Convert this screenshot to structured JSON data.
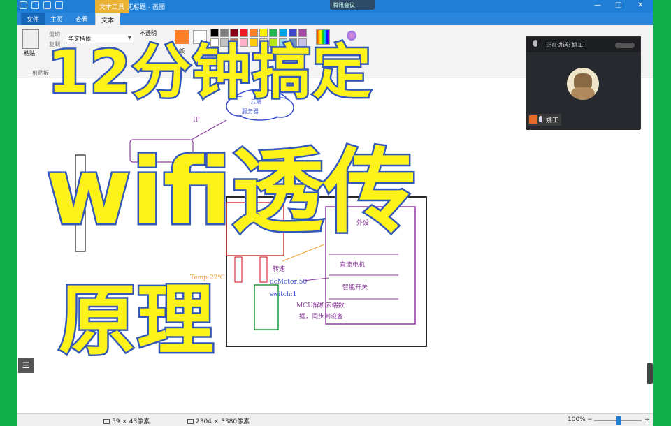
{
  "window": {
    "context_tab": "文本工具",
    "title": "无标题 - 画图",
    "meeting_label": "腾讯会议",
    "minimize": "—",
    "maximize": "□",
    "close": "✕"
  },
  "tabs": [
    {
      "label": "文件"
    },
    {
      "label": "主页"
    },
    {
      "label": "查看"
    },
    {
      "label": "文本"
    }
  ],
  "ribbon": {
    "paste": "粘贴",
    "cut": "剪切",
    "copy": "复制",
    "clipboard_group": "剪贴板",
    "font_name": "华文楷体",
    "opaque": "不透明",
    "palette": [
      "#000000",
      "#7f7f7f",
      "#880015",
      "#ed1c24",
      "#ff7f27",
      "#fff200",
      "#22b14c",
      "#00a2e8",
      "#3f48cc",
      "#a349a4",
      "#ffffff",
      "#c3c3c3",
      "#b97a57",
      "#ffaec9",
      "#ffc90e",
      "#efe4b0",
      "#b5e61d",
      "#99d9ea",
      "#7092be",
      "#c8bfe7"
    ],
    "color1_hex": "#ff7f27",
    "color2_hex": "#ffffff",
    "color1_label": "颜",
    "color2_label": ""
  },
  "diagram": {
    "cloud_line1": "云端",
    "cloud_line2": "服务器",
    "ip_label": "IP",
    "temp_label": "Temp:22℃",
    "dcmotor_label": "dcMotor:50",
    "switch_label": "switch:1",
    "speed_label": "转速",
    "mcu_line1": "MCU解析云端数",
    "mcu_line2": "据，同步到设备",
    "motor_label": "直流电机",
    "smart_switch_label": "智能开关",
    "module_label": "外设",
    "colors": {
      "black": "#111111",
      "red": "#d9343a",
      "purple": "#8e3b9e",
      "blue": "#3a4fd0",
      "orange": "#f0a030",
      "green": "#1a9a3a"
    }
  },
  "call": {
    "speaking": "正在讲话: 姚工;",
    "name": "姚工"
  },
  "overlay": {
    "line1": "12分钟搞定",
    "line2": "wifi透传",
    "line3": "原理",
    "fill": "#fdf21a",
    "stroke": "#3458b8"
  },
  "status": {
    "selection_size": "59 × 43像素",
    "image_size": "2304 × 3380像素",
    "zoom": "100%",
    "zoom_out": "−",
    "zoom_in": "+"
  }
}
